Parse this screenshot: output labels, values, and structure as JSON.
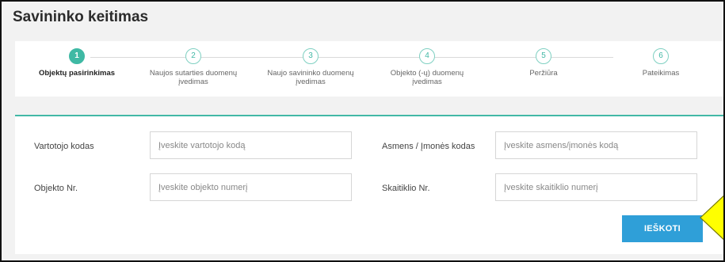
{
  "page": {
    "title": "Savininko keitimas"
  },
  "stepper": {
    "steps": [
      {
        "number": "1",
        "label": "Objektų pasirinkimas",
        "active": true
      },
      {
        "number": "2",
        "label": "Naujos sutarties duomenų įvedimas",
        "active": false
      },
      {
        "number": "3",
        "label": "Naujo savininko duomenų įvedimas",
        "active": false
      },
      {
        "number": "4",
        "label": "Objekto (-ų) duomenų įvedimas",
        "active": false
      },
      {
        "number": "5",
        "label": "Peržiūra",
        "active": false
      },
      {
        "number": "6",
        "label": "Pateikimas",
        "active": false
      }
    ]
  },
  "form": {
    "user_code": {
      "label": "Vartotojo kodas",
      "value": "",
      "placeholder": "Įveskite vartotojo kodą"
    },
    "person_code": {
      "label": "Asmens / Įmonės kodas",
      "value": "",
      "placeholder": "Įveskite asmens/įmonės kodą"
    },
    "object_no": {
      "label": "Objekto Nr.",
      "value": "",
      "placeholder": "Įveskite objekto numerį"
    },
    "meter_no": {
      "label": "Skaitiklio Nr.",
      "value": "",
      "placeholder": "Įveskite skaitiklio numerį"
    },
    "search_label": "IEŠKOTI"
  },
  "colors": {
    "accent": "#3fb9a4",
    "button": "#2f9fd8",
    "pointer": "#ffff00"
  },
  "icons": {
    "pointer": "arrow-pointer-icon"
  }
}
